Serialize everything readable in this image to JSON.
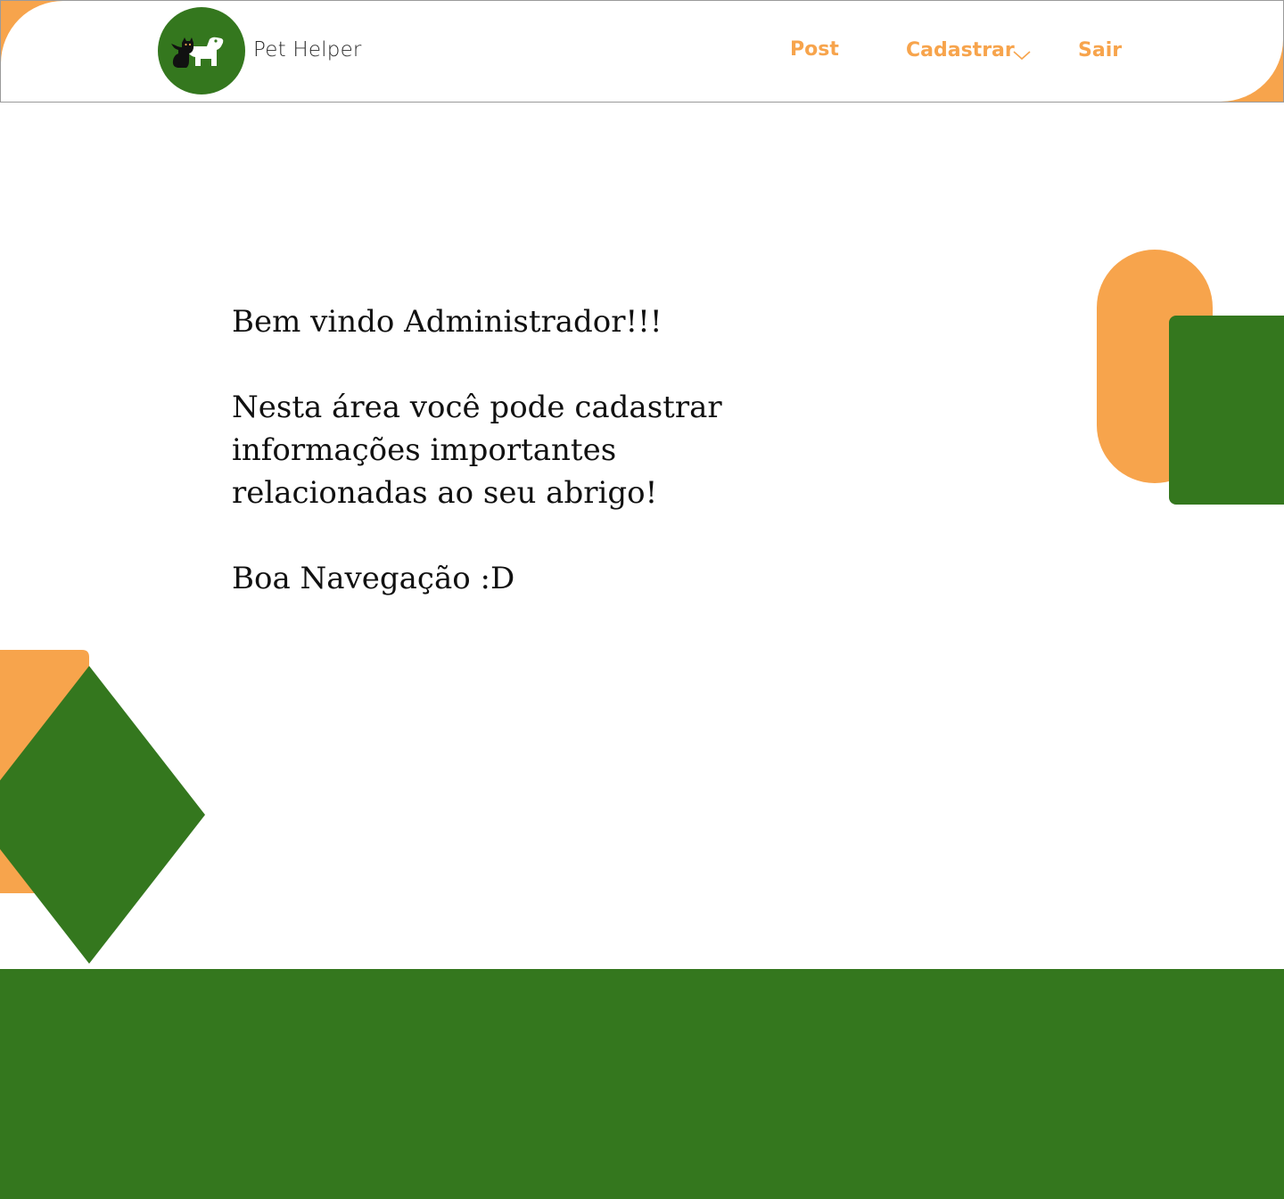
{
  "header": {
    "brand_name": "Pet Helper",
    "logo_icon": "cat-and-dog-icon",
    "nav": {
      "post": "Post",
      "cadastrar": "Cadastrar",
      "sair": "Sair"
    },
    "dropdown_icon": "chevron-down-icon"
  },
  "main": {
    "welcome_title": "Bem vindo Administrador!!!",
    "description_line1": "Nesta área você pode cadastrar informações importantes",
    "description_line2": "relacionadas ao seu abrigo!",
    "closing": "Boa Navegação :D"
  },
  "colors": {
    "brand_green": "#34771e",
    "accent_orange": "#f7a44c",
    "text_dark": "#111111",
    "background": "#ffffff"
  }
}
